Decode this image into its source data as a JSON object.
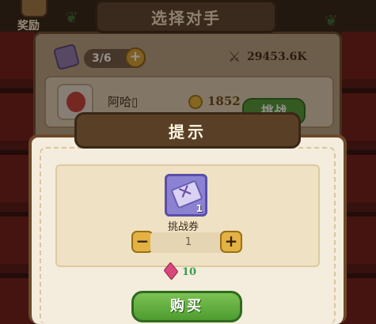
{
  "background": {
    "reward_label": "奖励",
    "panel_title": "选择对手",
    "ticket_count": "3/6",
    "power_total": "29453.6K",
    "opponent": {
      "name": "阿哈▯",
      "power": "1852",
      "challenge_label": "挑战"
    }
  },
  "modal": {
    "title": "提示",
    "item": {
      "name": "挑战券",
      "quantity_badge": "1",
      "icon": "ticket-icon"
    },
    "stepper": {
      "minus": "−",
      "value": "1",
      "plus": "+"
    },
    "price": {
      "currency_icon": "gem-icon",
      "value": "10"
    },
    "buy_label": "购买"
  },
  "colors": {
    "accent_green": "#4e9c30",
    "price_green": "#3b9a4e",
    "plate_brown": "#5a3f27",
    "ticket_purple": "#8b83d2"
  }
}
